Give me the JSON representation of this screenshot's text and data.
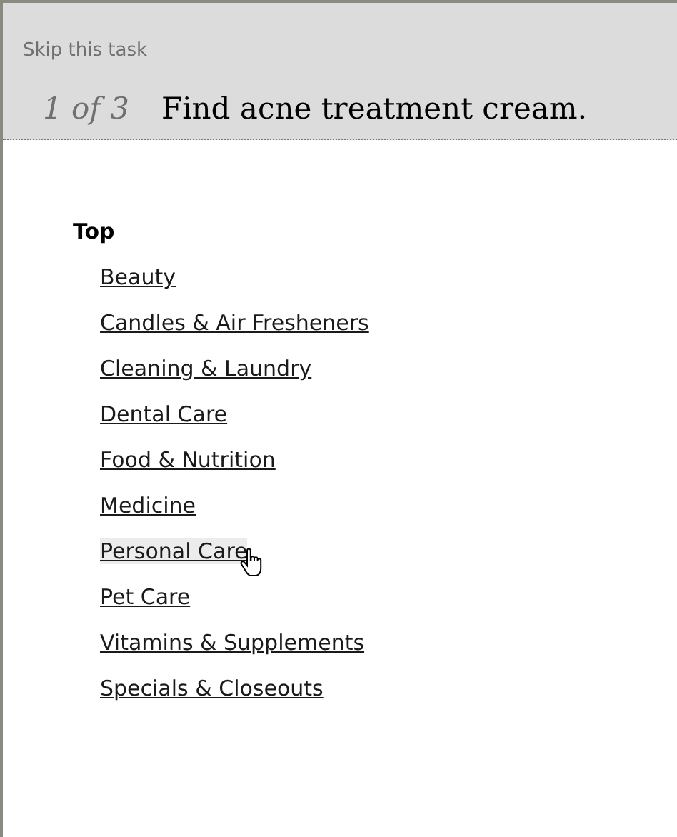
{
  "header": {
    "skip_link": "Skip this task",
    "progress": "1 of 3",
    "task": "Find acne treatment cream."
  },
  "category_tree": {
    "heading": "Top",
    "items": [
      {
        "label": "Beauty",
        "hovered": false
      },
      {
        "label": "Candles & Air Fresheners",
        "hovered": false
      },
      {
        "label": "Cleaning & Laundry",
        "hovered": false
      },
      {
        "label": "Dental Care",
        "hovered": false
      },
      {
        "label": "Food & Nutrition",
        "hovered": false
      },
      {
        "label": "Medicine",
        "hovered": false
      },
      {
        "label": "Personal Care",
        "hovered": true
      },
      {
        "label": "Pet Care",
        "hovered": false
      },
      {
        "label": "Vitamins & Supplements",
        "hovered": false
      },
      {
        "label": "Specials & Closeouts",
        "hovered": false
      }
    ]
  }
}
